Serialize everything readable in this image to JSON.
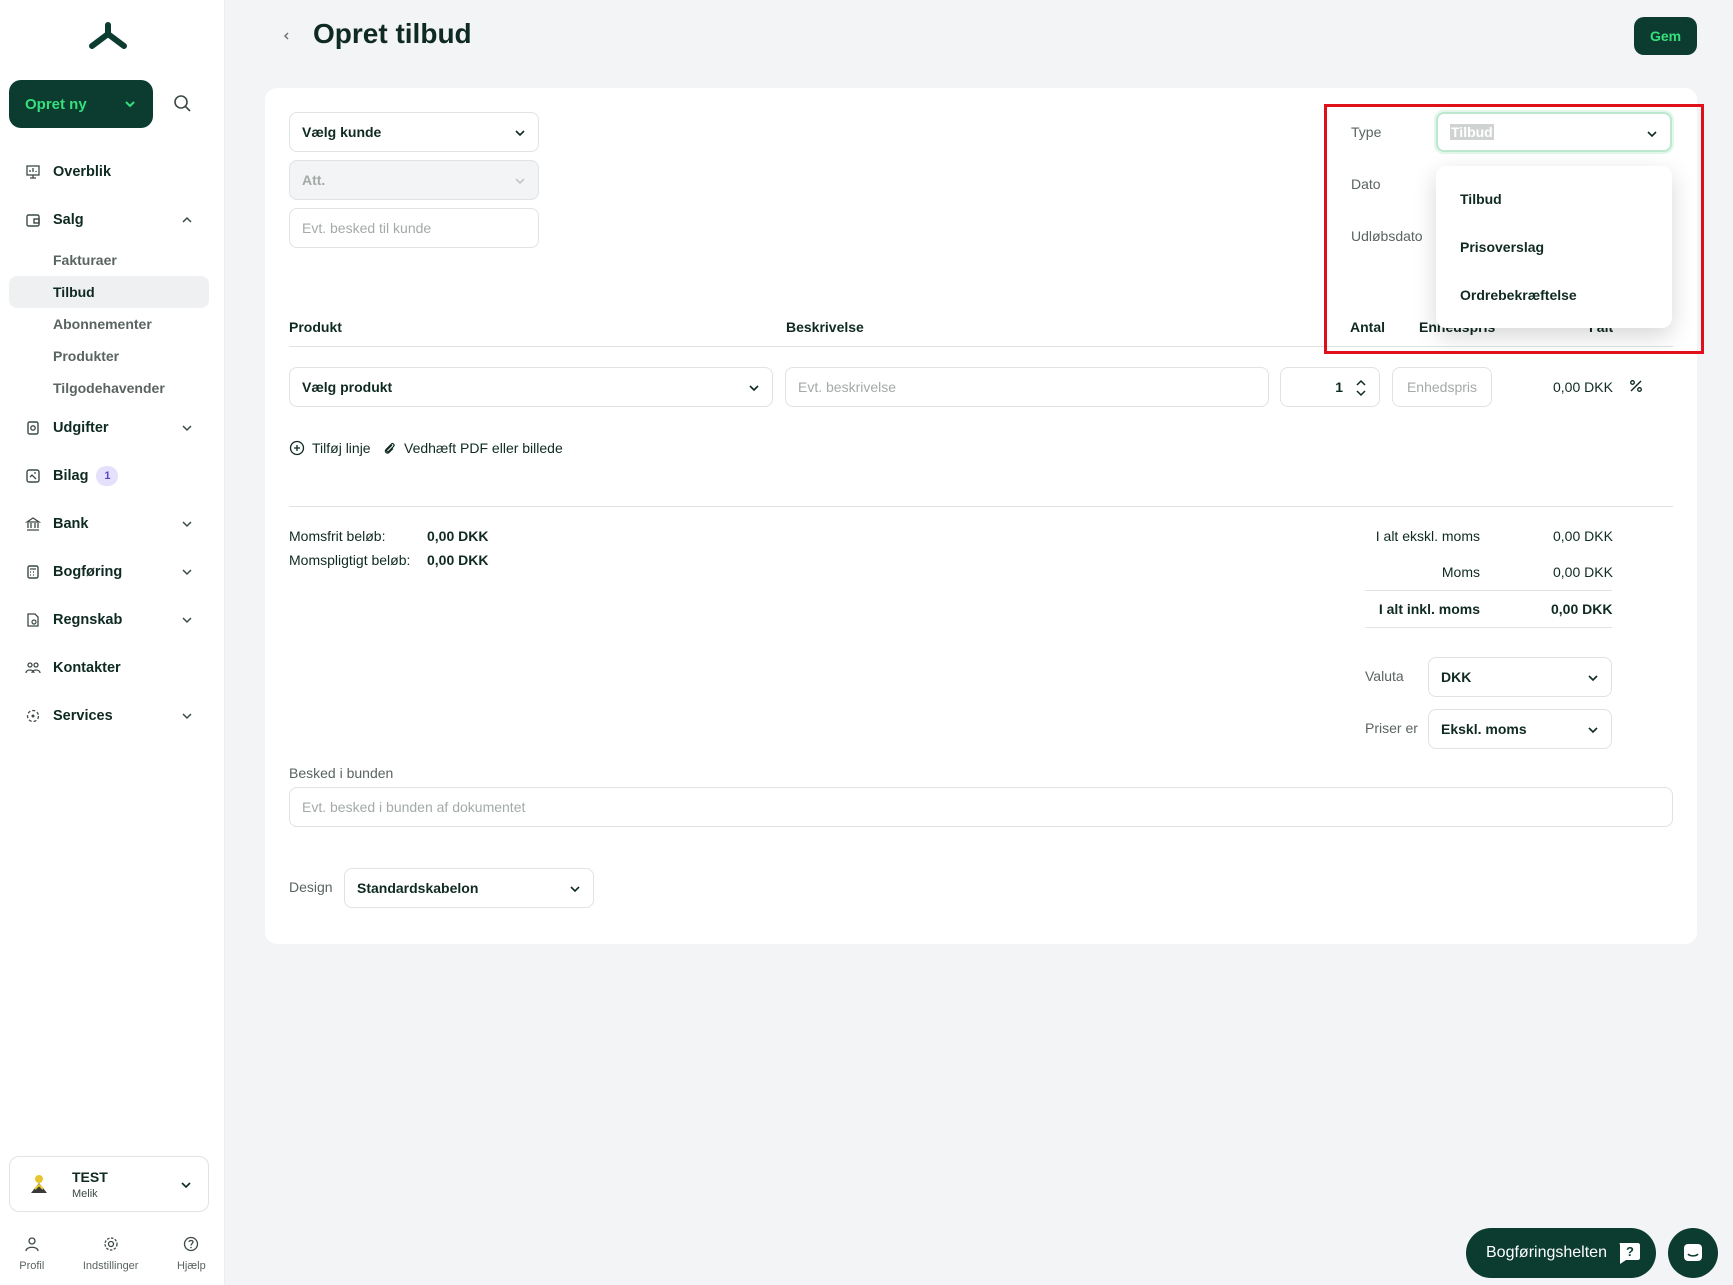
{
  "sidebar": {
    "create_label": "Opret ny",
    "items": [
      {
        "label": "Overblik"
      },
      {
        "label": "Salg"
      },
      {
        "label": "Udgifter"
      },
      {
        "label": "Bilag",
        "badge": "1"
      },
      {
        "label": "Bank"
      },
      {
        "label": "Bogføring"
      },
      {
        "label": "Regnskab"
      },
      {
        "label": "Kontakter"
      },
      {
        "label": "Services"
      }
    ],
    "salg_sub": [
      "Fakturaer",
      "Tilbud",
      "Abonnementer",
      "Produkter",
      "Tilgodehavender"
    ],
    "company": {
      "name": "TEST",
      "user": "Melik"
    },
    "tools": [
      "Profil",
      "Indstillinger",
      "Hjælp"
    ]
  },
  "header": {
    "title": "Opret tilbud",
    "save_label": "Gem"
  },
  "customer": {
    "select_label": "Vælg kunde",
    "att_label": "Att.",
    "message_placeholder": "Evt. besked til kunde"
  },
  "meta": {
    "type_label": "Type",
    "type_value": "Tilbud",
    "dato_label": "Dato",
    "udlob_label": "Udløbsdato",
    "type_options": [
      "Tilbud",
      "Prisoverslag",
      "Ordrebekræftelse"
    ]
  },
  "lines": {
    "headers": {
      "produkt": "Produkt",
      "beskrivelse": "Beskrivelse",
      "antal": "Antal",
      "enhedspris": "Enhedspris",
      "ialt": "I alt"
    },
    "product_select": "Vælg produkt",
    "desc_placeholder": "Evt. beskrivelse",
    "qty": "1",
    "unit_placeholder": "Enhedspris",
    "line_total": "0,00 DKK",
    "add_line": "Tilføj linje",
    "attach": "Vedhæft PDF eller billede"
  },
  "summary": {
    "momsfri_label": "Momsfrit beløb:",
    "momsfri_value": "0,00 DKK",
    "momspligtig_label": "Momspligtigt beløb:",
    "momspligtig_value": "0,00 DKK",
    "excl_label": "I alt ekskl. moms",
    "excl_value": "0,00 DKK",
    "moms_label": "Moms",
    "moms_value": "0,00 DKK",
    "incl_label": "I alt inkl. moms",
    "incl_value": "0,00 DKK",
    "valuta_label": "Valuta",
    "valuta_value": "DKK",
    "priser_label": "Priser er",
    "priser_value": "Ekskl. moms"
  },
  "footer": {
    "besked_label": "Besked i bunden",
    "besked_placeholder": "Evt. besked i bunden af dokumentet",
    "design_label": "Design",
    "design_value": "Standardskabelon"
  },
  "floating": {
    "helper_label": "Bogføringshelten"
  }
}
